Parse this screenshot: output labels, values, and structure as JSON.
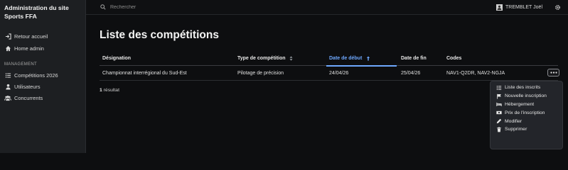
{
  "sidebar": {
    "brand": "Administration du site Sports FFA",
    "nav": [
      {
        "label": "Retour accueil",
        "icon": "sign-in-icon"
      },
      {
        "label": "Home admin",
        "icon": "home-icon"
      }
    ],
    "section_label": "MANAGEMENT",
    "management": [
      {
        "label": "Compétitions 2026",
        "icon": "list-icon"
      },
      {
        "label": "Utilisateurs",
        "icon": "user-icon"
      },
      {
        "label": "Concurrents",
        "icon": "users-icon"
      }
    ]
  },
  "topbar": {
    "search_placeholder": "Rechercher",
    "user_name": "TREMBLET Joël"
  },
  "page": {
    "title": "Liste des compétitions",
    "result_count": "1",
    "result_label": "résultat"
  },
  "table": {
    "columns": {
      "designation": "Désignation",
      "type": "Type de compétition",
      "start": "Date de début",
      "end": "Date de fin",
      "codes": "Codes"
    },
    "rows": [
      {
        "designation": "Championnat interrégional du Sud-Est",
        "type": "Pilotage de précision",
        "start": "24/04/26",
        "end": "25/04/26",
        "codes": "NAV1-Q2DR, NAV2-NGJA"
      }
    ]
  },
  "dropdown": {
    "items": [
      {
        "label": "Liste des inscrits",
        "icon": "list-icon"
      },
      {
        "label": "Nouvelle inscription",
        "icon": "flag-icon"
      },
      {
        "label": "Hébergement",
        "icon": "bed-icon"
      },
      {
        "label": "Prix de l'inscription",
        "icon": "ticket-icon"
      },
      {
        "label": "Modifier",
        "icon": "pencil-icon"
      },
      {
        "label": "Supprimer",
        "icon": "trash-icon"
      }
    ]
  },
  "colors": {
    "accent": "#6ea8fe",
    "sidebar_bg": "#1d1f22",
    "page_bg": "#0d0e10"
  }
}
